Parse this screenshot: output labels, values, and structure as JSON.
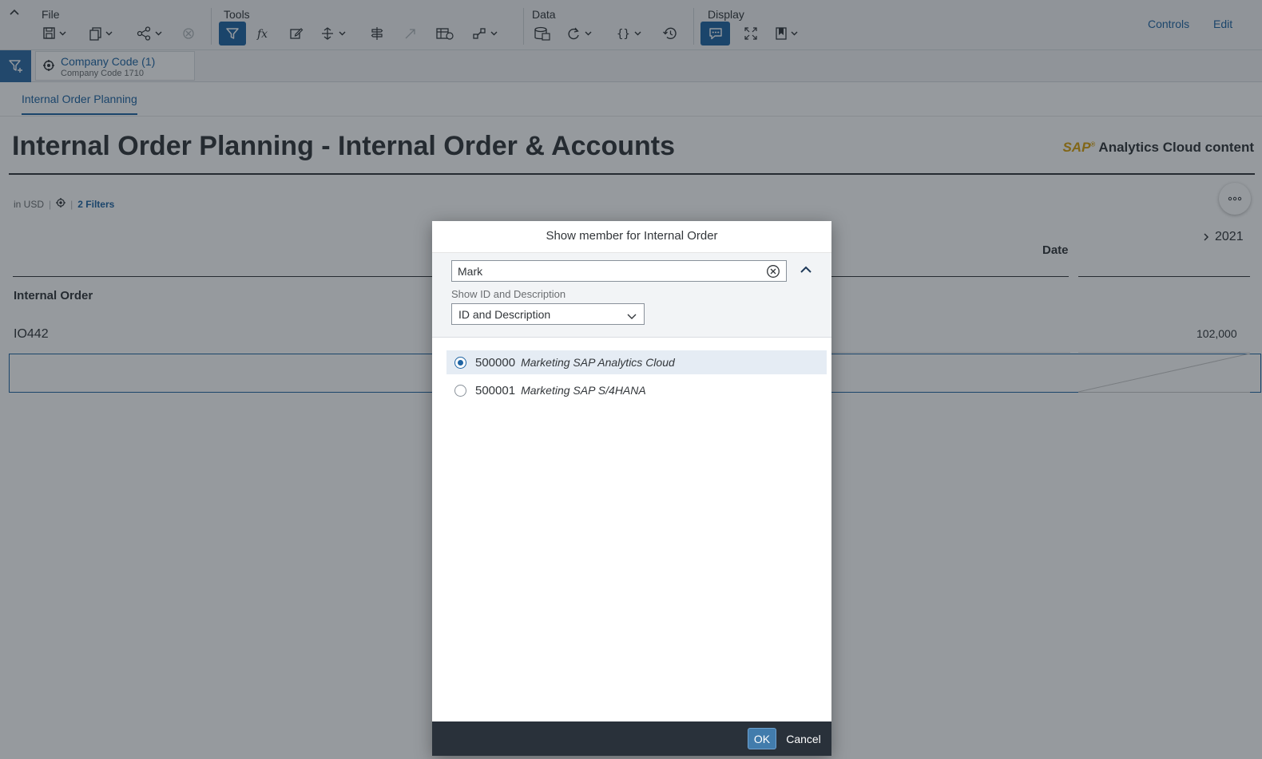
{
  "toolbar": {
    "groups": {
      "file": "File",
      "tools": "Tools",
      "data": "Data",
      "display": "Display"
    },
    "right_links": {
      "controls": "Controls",
      "edit": "Edit"
    },
    "active_color": "#1f64a3"
  },
  "filter_bar": {
    "token_title": "Company Code (1)",
    "token_subtitle": "Company Code 1710"
  },
  "page_tabs": [
    "Internal Order Planning"
  ],
  "story": {
    "title": "Internal Order Planning - Internal Order & Accounts",
    "brand_sap": "SAP",
    "brand_rest": "Analytics Cloud content",
    "currency": "in USD",
    "filters_link": "2 Filters",
    "table": {
      "column_header": "Date",
      "year": "2021",
      "row_header": "Internal Order",
      "row_id": "IO442",
      "row_value": "102,000"
    }
  },
  "dialog": {
    "title": "Show member for Internal Order",
    "search_value": "Mark",
    "show_label": "Show ID and Description",
    "display_select": "ID and Description",
    "members": [
      {
        "id": "500000",
        "description": "Marketing SAP Analytics Cloud",
        "selected": true
      },
      {
        "id": "500001",
        "description": "Marketing SAP S/4HANA",
        "selected": false
      }
    ],
    "ok": "OK",
    "cancel": "Cancel"
  }
}
